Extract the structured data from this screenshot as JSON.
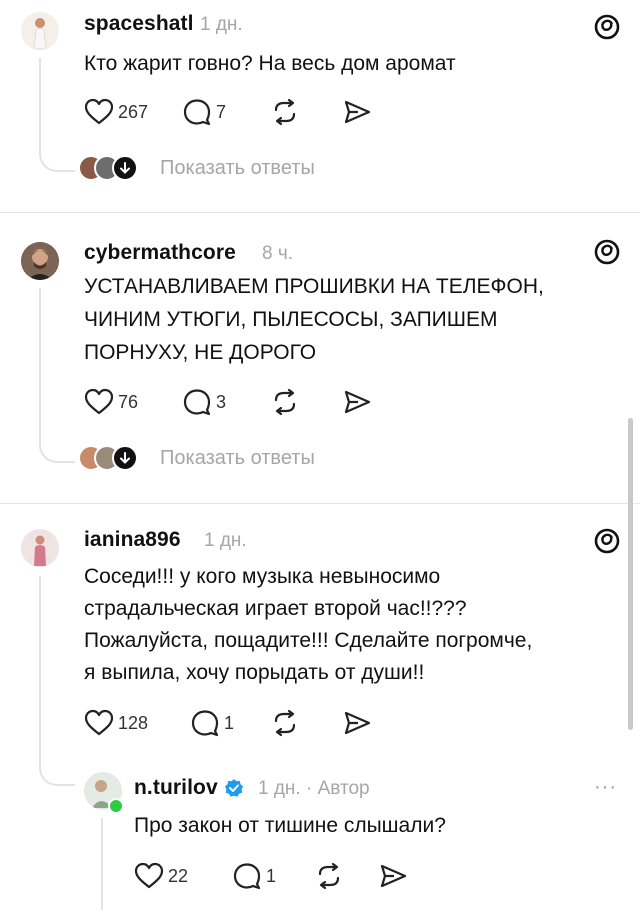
{
  "posts": [
    {
      "username": "spaceshatl",
      "time": "1 дн.",
      "text": "Кто жарит говно? На весь дом аромат",
      "likes": "267",
      "comments": "7",
      "replies_label": "Показать ответы",
      "badge_icon": "threads-logo-icon"
    },
    {
      "username": "cybermathcore",
      "time": "8 ч.",
      "text_lines": [
        "УСТАНАВЛИВАЕМ ПРОШИВКИ НА ТЕЛЕФОН,",
        "ЧИНИМ УТЮГИ, ПЫЛЕСОСЫ, ЗАПИШЕМ",
        "ПОРНУХУ, НЕ ДОРОГО"
      ],
      "likes": "76",
      "comments": "3",
      "replies_label": "Показать ответы",
      "badge_icon": "threads-logo-icon"
    },
    {
      "username": "ianina896",
      "time": "1 дн.",
      "text_lines": [
        "Соседи!!! у кого музыка невыносимо",
        "страдальческая играет второй час!!???",
        "Пожалуйста, пощадите!!! Сделайте погромче,",
        "я выпила, хочу порыдать от души!!"
      ],
      "likes": "128",
      "comments": "1",
      "badge_icon": "threads-logo-icon"
    }
  ],
  "reply": {
    "username": "n.turilov",
    "time": "1 дн.",
    "separator": "·",
    "author_label": "Автор",
    "text": "Про закон от тишине слышали?",
    "likes": "22",
    "comments": "1",
    "more": "···"
  },
  "colors": {
    "accent_verified": "#1d9bf0",
    "online_dot": "#2ecc40",
    "muted": "#a6a6a6"
  }
}
